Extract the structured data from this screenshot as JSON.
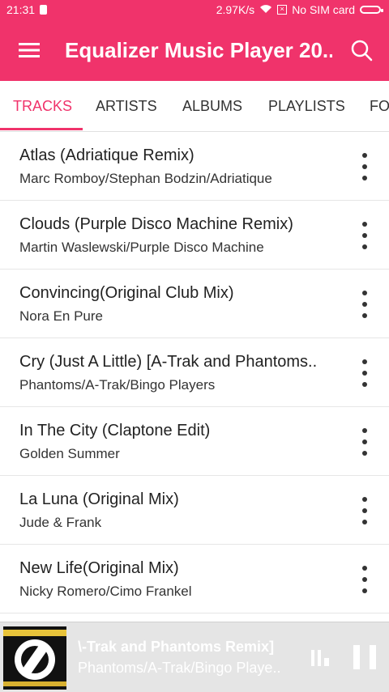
{
  "status": {
    "time": "21:31",
    "speed": "2.97K/s",
    "sim": "No SIM card"
  },
  "appbar": {
    "title": "Equalizer Music Player 20..."
  },
  "tabs": [
    {
      "label": "TRACKS",
      "active": true
    },
    {
      "label": "ARTISTS",
      "active": false
    },
    {
      "label": "ALBUMS",
      "active": false
    },
    {
      "label": "PLAYLISTS",
      "active": false
    },
    {
      "label": "FO",
      "active": false
    }
  ],
  "tracks": [
    {
      "title": "Atlas (Adriatique Remix)",
      "artist": "Marc Romboy/Stephan Bodzin/Adriatique"
    },
    {
      "title": "Clouds (Purple Disco Machine Remix)",
      "artist": "Martin Waslewski/Purple Disco Machine"
    },
    {
      "title": "Convincing(Original Club Mix)",
      "artist": "Nora En Pure"
    },
    {
      "title": "Cry (Just A Little) [A-Trak and Phantoms..",
      "artist": "Phantoms/A-Trak/Bingo Players"
    },
    {
      "title": "In The City (Claptone Edit)",
      "artist": "Golden Summer"
    },
    {
      "title": "La Luna (Original Mix)",
      "artist": "Jude & Frank"
    },
    {
      "title": "New Life(Original Mix)",
      "artist": "Nicky Romero/Cimo Frankel"
    }
  ],
  "player": {
    "title": "\\-Trak and Phantoms Remix]",
    "artist": "Phantoms/A-Trak/Bingo Playe.."
  },
  "colors": {
    "accent": "#f0336b"
  },
  "icons": {
    "menu": "menu-icon",
    "search": "search-icon",
    "more": "more-vert-icon",
    "queue": "queue-icon",
    "pause": "pause-icon"
  }
}
